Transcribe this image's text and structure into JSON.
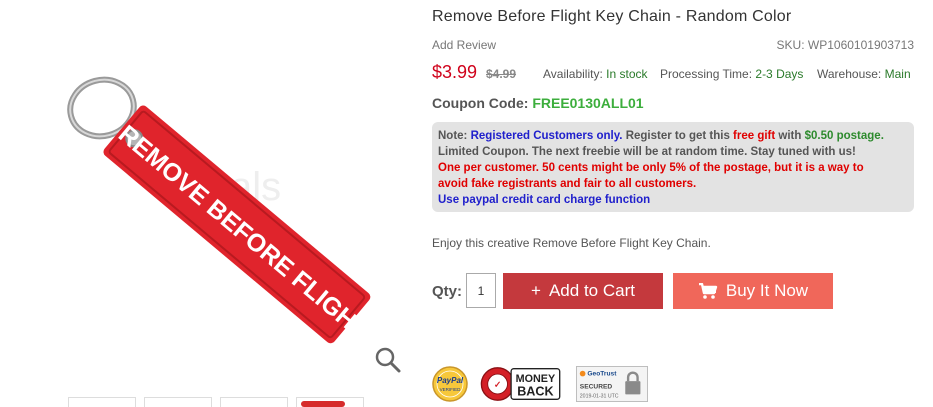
{
  "product": {
    "title": "Remove Before Flight Key Chain - Random Color",
    "add_review": "Add Review",
    "sku_label": "SKU:",
    "sku": "WP1060101903713",
    "price": "$3.99",
    "old_price": "$4.99",
    "availability_label": "Availability:",
    "availability": "In stock",
    "processing_label": "Processing Time:",
    "processing": "2-3 Days",
    "warehouse_label": "Warehouse:",
    "warehouse": "Main",
    "coupon_label": "Coupon Code:",
    "coupon_code": "FREE0130ALL01",
    "description": "Enjoy this creative Remove Before Flight Key Chain.",
    "image_text": "REMOVE BEFORE FLIGHT"
  },
  "note": {
    "label": "Note:",
    "registered": "Registered Customers only.",
    "register_text": "Register to get this",
    "free_gift": "free gift",
    "with": "with",
    "postage": "$0.50 postage.",
    "line2": "Limited Coupon. The next freebie will be at random time. Stay tuned with us!",
    "line3": "One per customer. 50 cents might be only 5% of the postage, but it is a way to",
    "line4": "avoid fake registrants and fair to all customers.",
    "line5": "Use paypal credit card charge function"
  },
  "purchase": {
    "qty_label": "Qty:",
    "qty_value": "1",
    "add_to_cart": "Add to Cart",
    "buy_now": "Buy It Now"
  },
  "badges": {
    "paypal": "PayPal",
    "paypal_sub": "VERIFIED",
    "money_back_1": "MONEY",
    "money_back_2": "BACK",
    "geotrust": "GeoTrust",
    "secured": "SECURED",
    "secured_date": "2019-01-31 UTC"
  },
  "colors": {
    "price": "#d0021b",
    "coupon": "#3cae3c",
    "add_to_cart_bg": "#c4393d",
    "buy_now_bg": "#f0675a",
    "keychain": "#e0242c"
  }
}
